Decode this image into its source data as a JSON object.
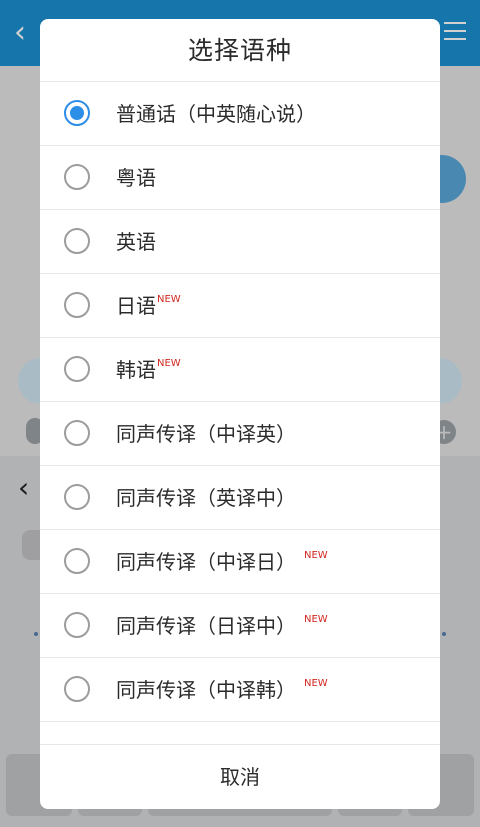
{
  "background": {
    "back_glyph": "‹",
    "keyboard_back_glyph": "‹",
    "plus_glyph": "+"
  },
  "dialog": {
    "title": "选择语种",
    "cancel_label": "取消",
    "selected_index": 0,
    "options": [
      {
        "label": "普通话（中英随心说）",
        "badge": ""
      },
      {
        "label": "粤语",
        "badge": ""
      },
      {
        "label": "英语",
        "badge": ""
      },
      {
        "label": "日语",
        "badge": "NEW"
      },
      {
        "label": "韩语",
        "badge": "NEW"
      },
      {
        "label": "同声传译（中译英）",
        "badge": ""
      },
      {
        "label": "同声传译（英译中）",
        "badge": ""
      },
      {
        "label": "同声传译（中译日）",
        "badge": "NEW"
      },
      {
        "label": "同声传译（日译中）",
        "badge": "NEW"
      },
      {
        "label": "同声传译（中译韩）",
        "badge": "NEW"
      }
    ]
  },
  "colors": {
    "accent": "#2d8ee8",
    "badge": "#d0281f",
    "header": "#1b8fd0"
  }
}
